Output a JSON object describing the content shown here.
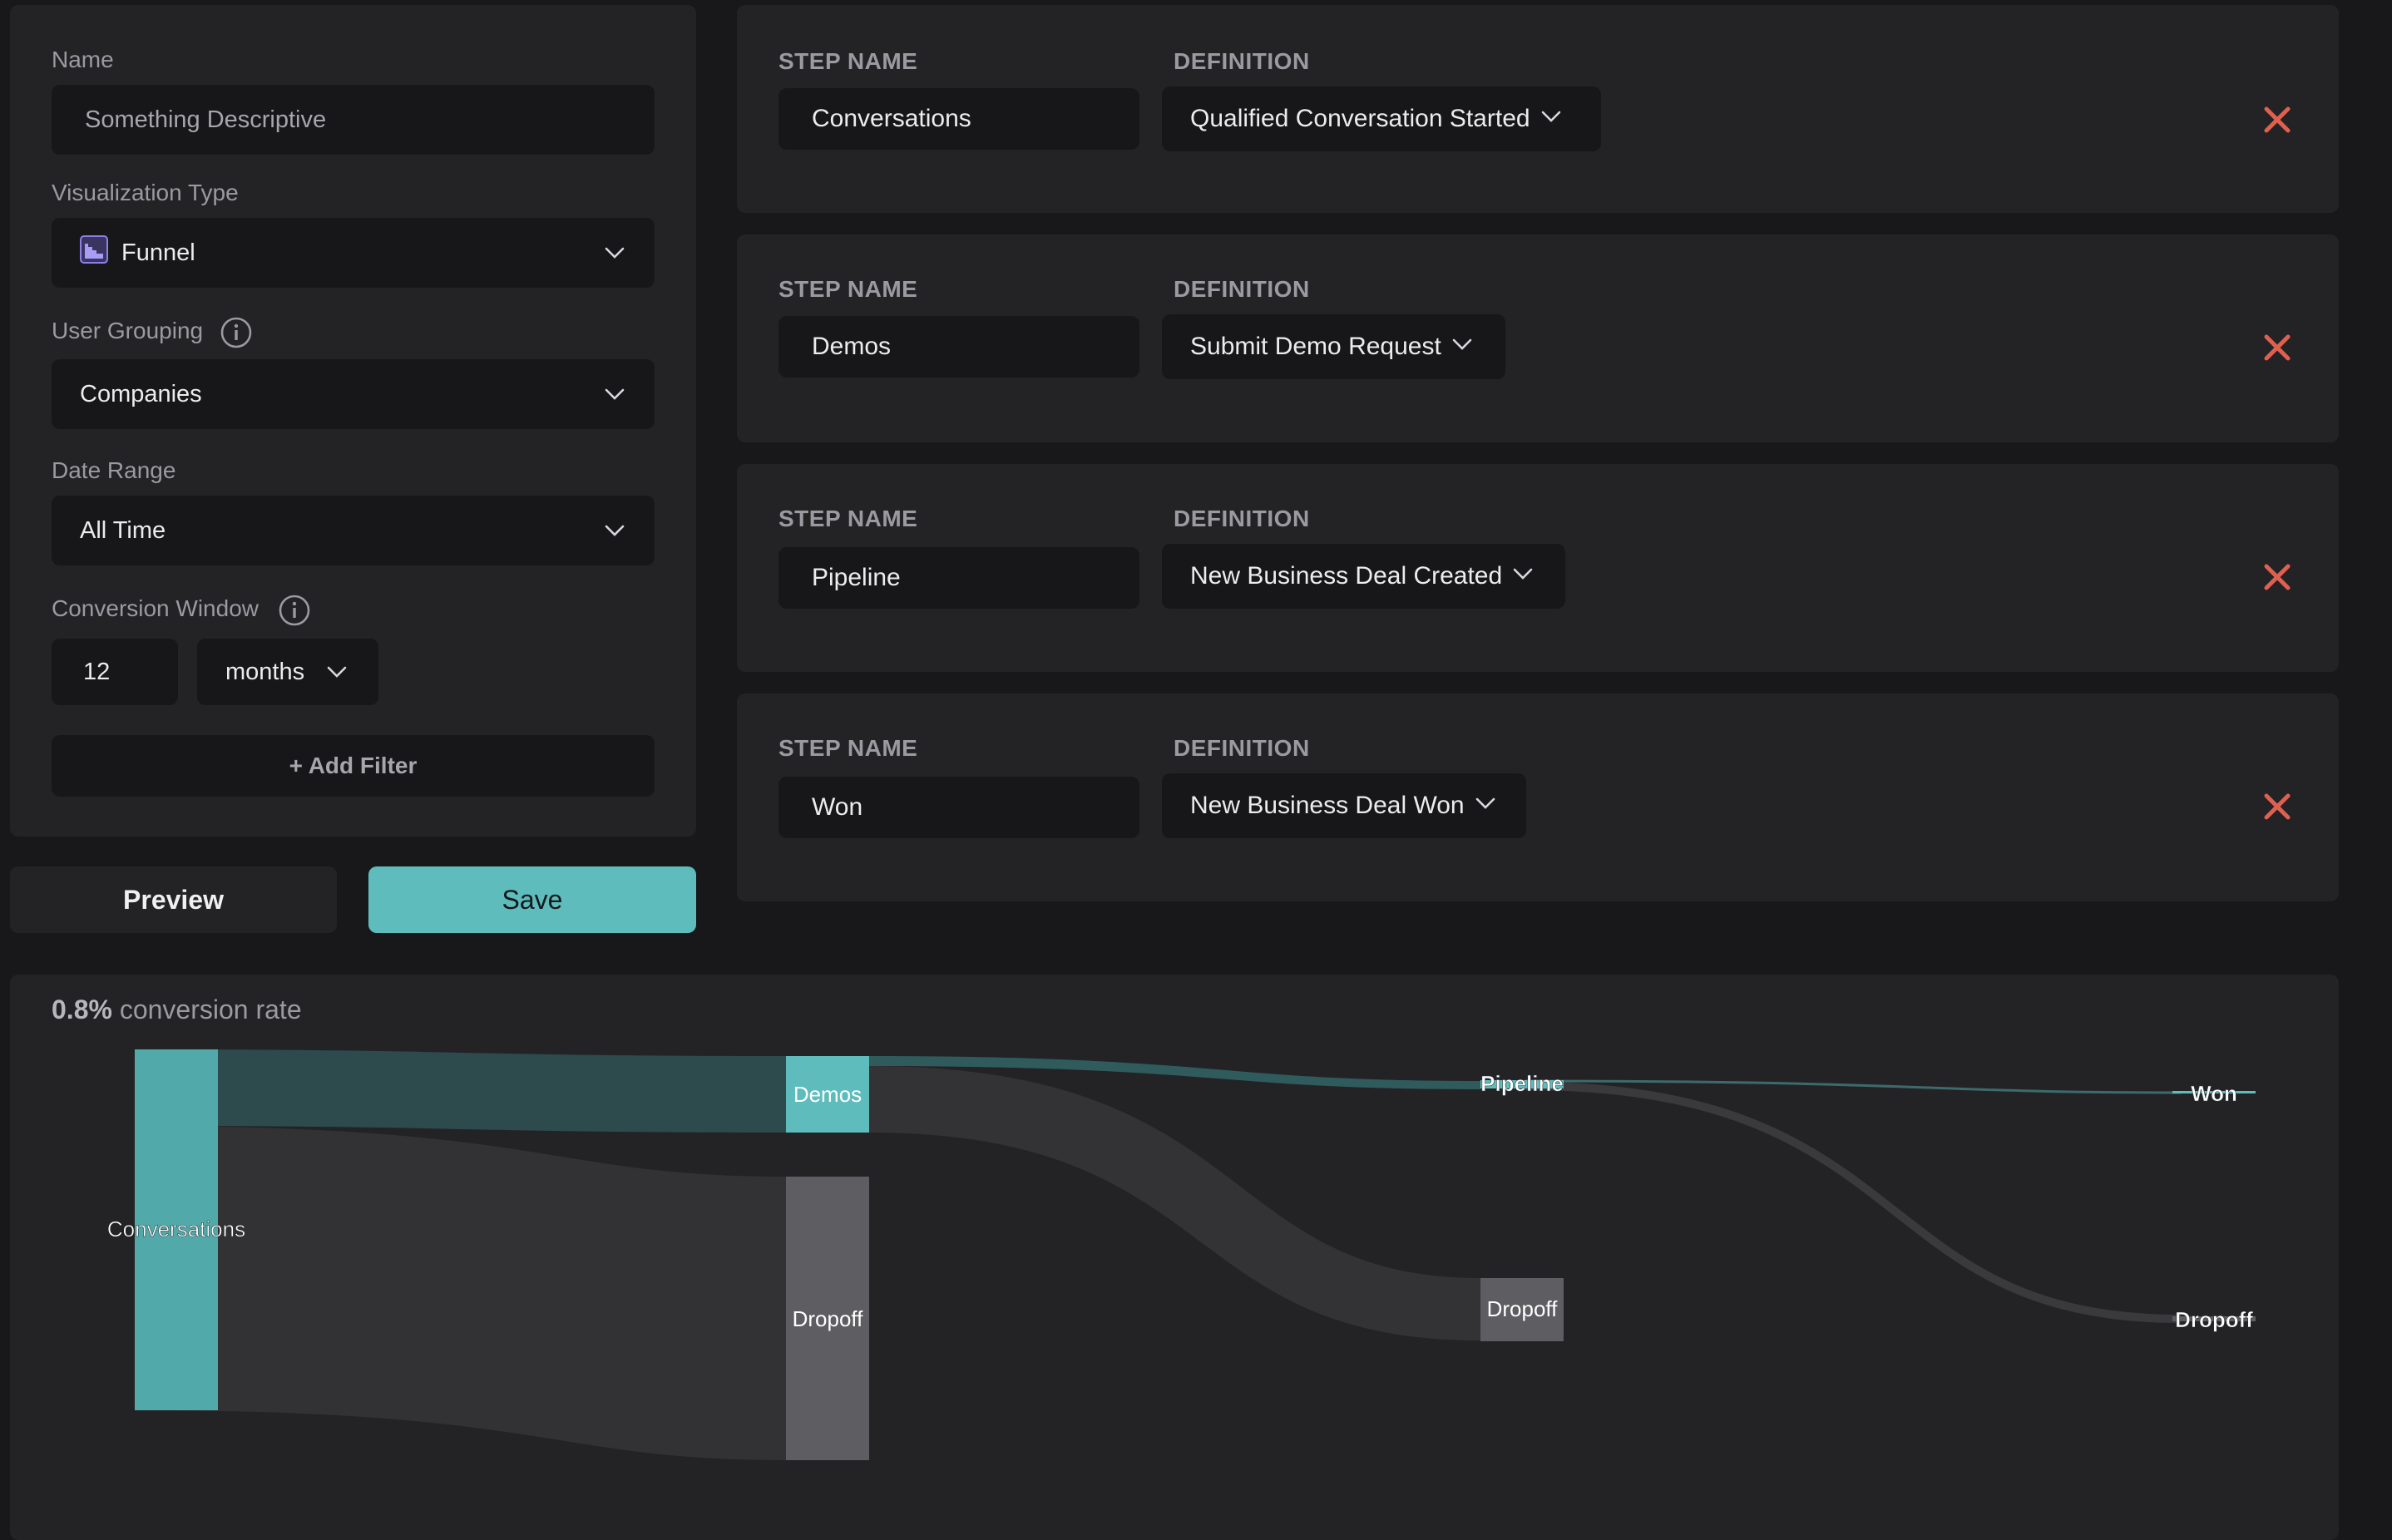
{
  "form": {
    "name_label": "Name",
    "name_placeholder": "Something Descriptive",
    "viz_label": "Visualization Type",
    "viz_value": "Funnel",
    "grouping_label": "User Grouping",
    "grouping_value": "Companies",
    "date_label": "Date Range",
    "date_value": "All Time",
    "window_label": "Conversion Window",
    "window_number": "12",
    "window_unit": "months",
    "add_filter": "+ Add Filter"
  },
  "actions": {
    "preview": "Preview",
    "save": "Save"
  },
  "steps": [
    {
      "name_header": "STEP NAME",
      "def_header": "DEFINITION",
      "name": "Conversations",
      "definition": "Qualified Conversation Started"
    },
    {
      "name_header": "STEP NAME",
      "def_header": "DEFINITION",
      "name": "Demos",
      "definition": "Submit Demo Request"
    },
    {
      "name_header": "STEP NAME",
      "def_header": "DEFINITION",
      "name": "Pipeline",
      "definition": "New Business Deal Created"
    },
    {
      "name_header": "STEP NAME",
      "def_header": "DEFINITION",
      "name": "Won",
      "definition": "New Business Deal Won"
    }
  ],
  "chart": {
    "rate_value": "0.8%",
    "rate_label": "conversion rate",
    "nodes": {
      "conversations": "Conversations",
      "demos": "Demos",
      "dropoff1": "Dropoff",
      "pipeline": "Pipeline",
      "dropoff2": "Dropoff",
      "won": "Won",
      "dropoff3": "Dropoff"
    }
  },
  "colors": {
    "accent": "#5fbcbd",
    "danger": "#e0604f",
    "panel": "#232326",
    "background": "#18181a",
    "dropoff_node": "#5e5e62"
  },
  "icons": {
    "viz": "funnel-chart-icon",
    "chevron": "chevron-down-icon",
    "info": "info-icon",
    "remove": "close-icon"
  }
}
